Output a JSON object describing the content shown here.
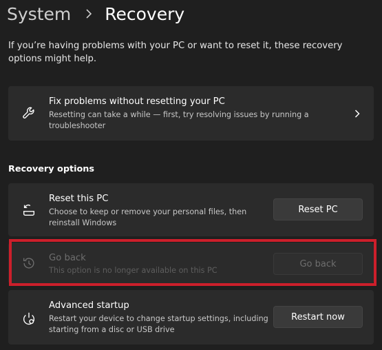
{
  "header": {
    "parent": "System",
    "current": "Recovery"
  },
  "intro": "If you’re having problems with your PC or want to reset it, these recovery options might help.",
  "fix_card": {
    "title": "Fix problems without resetting your PC",
    "desc": "Resetting can take a while — first, try resolving issues by running a troubleshooter",
    "icon": "wrench-icon"
  },
  "section": {
    "label": "Recovery options"
  },
  "options": [
    {
      "title": "Reset this PC",
      "desc": "Choose to keep or remove your personal files, then reinstall Windows",
      "button": "Reset PC",
      "icon": "reset-pc-icon"
    },
    {
      "title": "Go back",
      "desc": "This option is no longer available on this PC",
      "button": "Go back",
      "icon": "history-icon",
      "disabled": true
    },
    {
      "title": "Advanced startup",
      "desc": "Restart your device to change startup settings, including starting from a disc or USB drive",
      "button": "Restart now",
      "icon": "advanced-startup-icon"
    }
  ],
  "colors": {
    "background": "#1f1f1f",
    "card": "#2b2b2b",
    "highlight": "#cc1f2b"
  }
}
